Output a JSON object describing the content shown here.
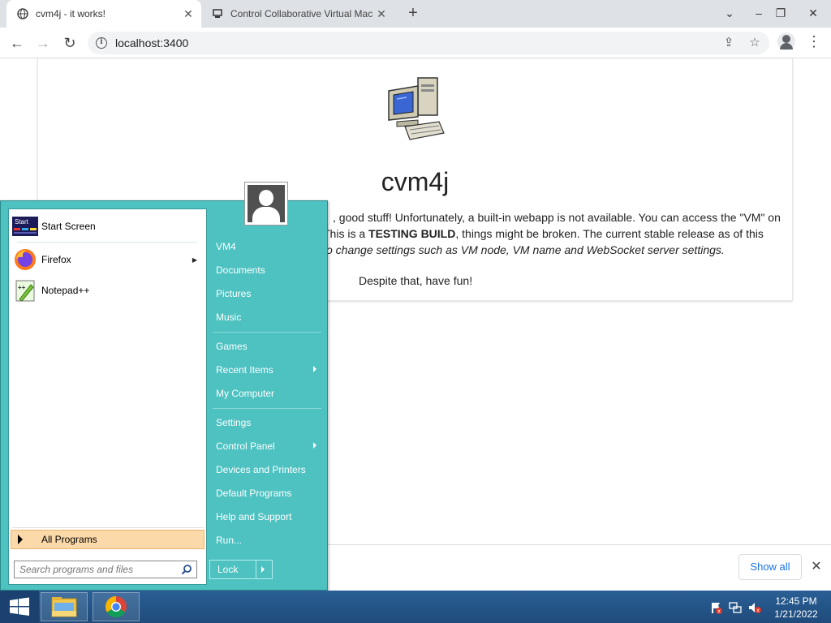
{
  "browser": {
    "tabs": [
      {
        "title": "cvm4j - it works!",
        "active": true
      },
      {
        "title": "Control Collaborative Virtual Mac",
        "active": false
      }
    ],
    "url": "localhost:3400"
  },
  "page": {
    "title": "cvm4j",
    "paragraph_line1": ", good stuff! Unfortunately, a built-in webapp is not available. You can access the \"VM\" on",
    "paragraph_line2_pre": "This is a ",
    "paragraph_line2_bold": "TESTING BUILD",
    "paragraph_line2_post": ", things might be broken. The current stable release as of this",
    "paragraph_line3": "o change settings such as VM node, VM name and WebSocket server settings.",
    "footer": "Despite that, have fun!"
  },
  "download_bar": {
    "show_all_label": "Show all"
  },
  "start_menu": {
    "pinned": [
      {
        "label": "Start Screen",
        "icon": "start-screen-icon",
        "icon_text": "Start",
        "submenu": false
      },
      {
        "label": "Firefox",
        "icon": "firefox-icon",
        "submenu": true
      },
      {
        "label": "Notepad++",
        "icon": "notepad-plus-plus-icon",
        "submenu": false
      }
    ],
    "all_programs_label": "All Programs",
    "search_placeholder": "Search programs and files",
    "right_items": [
      {
        "label": "VM4",
        "submenu": false
      },
      {
        "label": "Documents",
        "submenu": false
      },
      {
        "label": "Pictures",
        "submenu": false
      },
      {
        "label": "Music",
        "submenu": false
      },
      {
        "label": "Games",
        "submenu": false
      },
      {
        "label": "Recent Items",
        "submenu": true
      },
      {
        "label": "My Computer",
        "submenu": false
      },
      {
        "label": "Settings",
        "submenu": false
      },
      {
        "label": "Control Panel",
        "submenu": true
      },
      {
        "label": "Devices and Printers",
        "submenu": false
      },
      {
        "label": "Default Programs",
        "submenu": false
      },
      {
        "label": "Help and Support",
        "submenu": false
      },
      {
        "label": "Run...",
        "submenu": false
      }
    ],
    "lock_label": "Lock"
  },
  "taskbar": {
    "time": "12:45 PM",
    "date": "1/21/2022"
  },
  "colors": {
    "start_menu_bg": "#4ec1c1",
    "all_programs_highlight": "#fcd9a8",
    "taskbar": "#245589"
  }
}
